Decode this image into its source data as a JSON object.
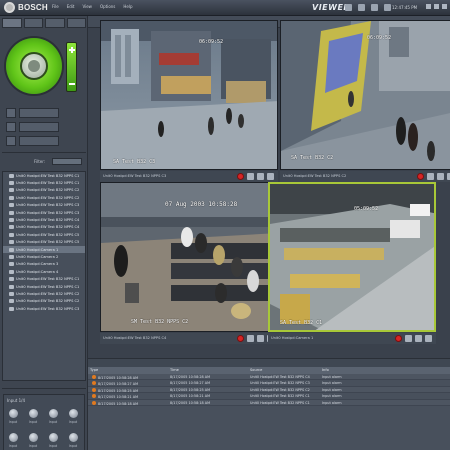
{
  "app": {
    "brand": "BOSCH",
    "title": "VIEWER",
    "clock": "12:47:45 PM",
    "menu": [
      "File",
      "Edit",
      "View",
      "Options",
      "Help"
    ]
  },
  "left_panel": {
    "filter_label": "Filter:",
    "cameras": [
      "Unit0 Hostpd:EW Test B32 NPPS C1",
      "Unit0 Hostpd:EW Test B32 NPPS C1",
      "Unit0 Hostpd:EW Test B32 NPPS C2",
      "Unit0 Hostpd:EW Test B32 NPPS C2",
      "Unit0 Hostpd:EW Test B32 NPPS C3",
      "Unit0 Hostpd:EW Test B32 NPPS C3",
      "Unit0 Hostpd:EW Test B32 NPPS C4",
      "Unit0 Hostpd:EW Test B32 NPPS C4",
      "Unit0 Hostpd:EW Test B32 NPPS C5",
      "Unit0 Hostpd:EW Test B32 NPPS C5",
      "Unit0 Hostpd:Camera 1",
      "Unit0 Hostpd:Camera 2",
      "Unit0 Hostpd:Camera 3",
      "Unit0 Hostpd:Camera 4",
      "Unit0 Hostpd:EW Test B32 NPPS C1",
      "Unit0 Hostpd:EW Test B32 NPPS C1",
      "Unit0 Hostpd:EW Test B32 NPPS C2",
      "Unit0 Hostpd:EW Test B32 NPPS C2",
      "Unit0 Hostpd:EW Test B32 NPPS C3"
    ],
    "audio_title": "Input 1/4",
    "audio_labels": [
      "Input",
      "Input",
      "Input",
      "Input",
      "Input",
      "Input",
      "Input",
      "Input"
    ]
  },
  "tiles": [
    {
      "name": "Unit0 Hostpd:EW Test B32 NPPS C3",
      "stamp_top": "06:09:52",
      "stamp_bottom": "SA Test B32 C3"
    },
    {
      "name": "Unit0 Hostpd:EW Test B32 NPPS C2",
      "stamp_top": "06:09:52",
      "stamp_bottom": "SA Test B32 C2"
    },
    {
      "name": "Unit0 Hostpd:EW Test B32 NPPS C4",
      "stamp_top": "07 Aug 2003   10:58:28",
      "stamp_bottom": "SM Test B32 NPPS C2"
    },
    {
      "name": "Unit0 Hostpd:Camera 1",
      "stamp_top": "05:09:52",
      "stamp_bottom": "SA Test B32 C1"
    }
  ],
  "events": {
    "columns": [
      "Type",
      "Time",
      "Source",
      "Info"
    ],
    "rows": [
      [
        "",
        "8/17/2005 10:58:28 AM",
        "8/17/2005 10:58:28 AM",
        "Unit0 Hostpd:EW Test B32 NPPS C4",
        "Input alarm"
      ],
      [
        "",
        "8/17/2005 10:58:27 AM",
        "8/17/2005 10:58:27 AM",
        "Unit0 Hostpd:EW Test B32 NPPS C3",
        "Input alarm"
      ],
      [
        "",
        "8/17/2005 10:58:25 AM",
        "8/17/2005 10:58:25 AM",
        "Unit0 Hostpd:EW Test B32 NPPS C2",
        "Input alarm"
      ],
      [
        "",
        "8/17/2005 10:58:21 AM",
        "8/17/2005 10:58:21 AM",
        "Unit0 Hostpd:EW Test B32 NPPS C1",
        "Input alarm"
      ],
      [
        "",
        "8/17/2005 10:58:18 AM",
        "8/17/2005 10:58:18 AM",
        "Unit0 Hostpd:EW Test B32 NPPS C1",
        "Input alarm"
      ]
    ]
  },
  "colors": {
    "accent_green": "#6ad21e",
    "active_border": "#a8c838",
    "record_red": "#d62424"
  }
}
